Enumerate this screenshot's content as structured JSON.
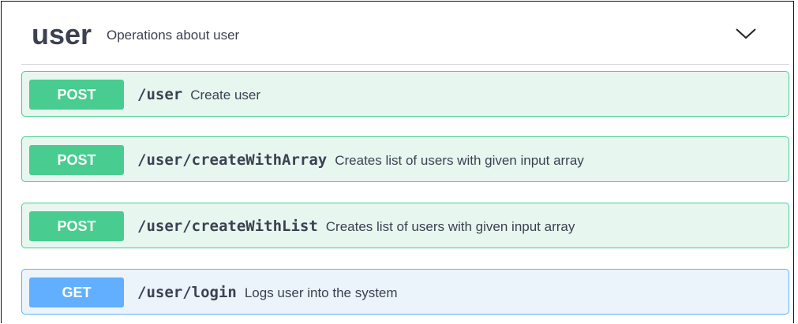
{
  "tag": {
    "name": "user",
    "description": "Operations about user",
    "toggle_icon": "chevron-down-icon"
  },
  "operations": [
    {
      "method": "POST",
      "path": "/user",
      "summary": "Create user"
    },
    {
      "method": "POST",
      "path": "/user/createWithArray",
      "summary": "Creates list of users with given input array"
    },
    {
      "method": "POST",
      "path": "/user/createWithList",
      "summary": "Creates list of users with given input array"
    },
    {
      "method": "GET",
      "path": "/user/login",
      "summary": "Logs user into the system"
    }
  ],
  "colors": {
    "post_accent": "#49cc90",
    "post_background": "#e8f6f0",
    "get_accent": "#61affe",
    "get_background": "#ebf3fb",
    "text": "#3b4151"
  }
}
